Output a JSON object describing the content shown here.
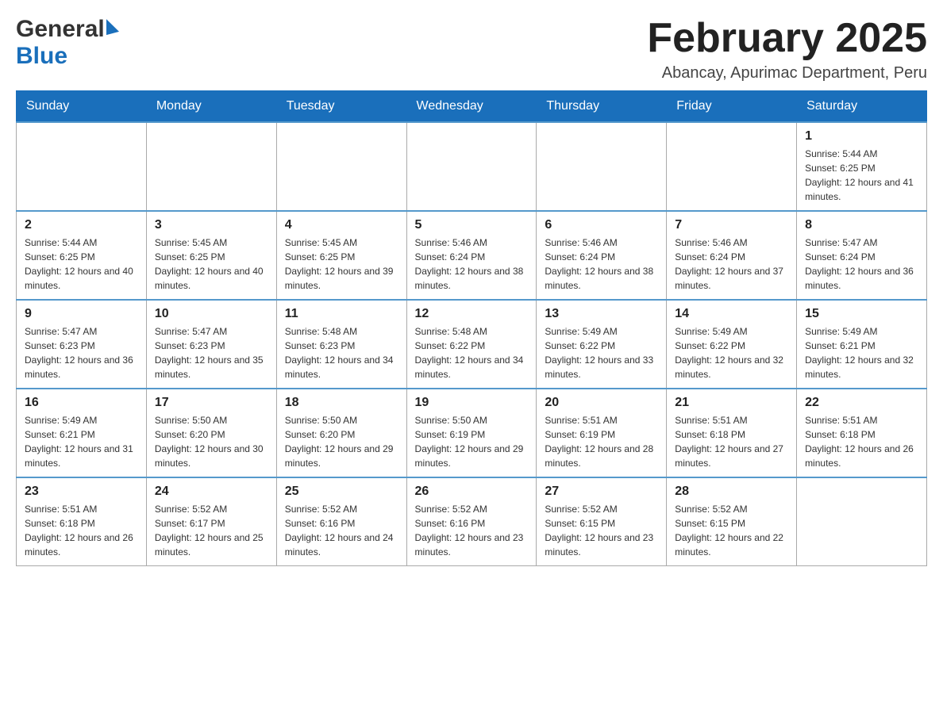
{
  "header": {
    "logo_general": "General",
    "logo_blue": "Blue",
    "month_title": "February 2025",
    "location": "Abancay, Apurimac Department, Peru"
  },
  "days_of_week": [
    "Sunday",
    "Monday",
    "Tuesday",
    "Wednesday",
    "Thursday",
    "Friday",
    "Saturday"
  ],
  "weeks": [
    [
      {
        "day": "",
        "info": ""
      },
      {
        "day": "",
        "info": ""
      },
      {
        "day": "",
        "info": ""
      },
      {
        "day": "",
        "info": ""
      },
      {
        "day": "",
        "info": ""
      },
      {
        "day": "",
        "info": ""
      },
      {
        "day": "1",
        "info": "Sunrise: 5:44 AM\nSunset: 6:25 PM\nDaylight: 12 hours and 41 minutes."
      }
    ],
    [
      {
        "day": "2",
        "info": "Sunrise: 5:44 AM\nSunset: 6:25 PM\nDaylight: 12 hours and 40 minutes."
      },
      {
        "day": "3",
        "info": "Sunrise: 5:45 AM\nSunset: 6:25 PM\nDaylight: 12 hours and 40 minutes."
      },
      {
        "day": "4",
        "info": "Sunrise: 5:45 AM\nSunset: 6:25 PM\nDaylight: 12 hours and 39 minutes."
      },
      {
        "day": "5",
        "info": "Sunrise: 5:46 AM\nSunset: 6:24 PM\nDaylight: 12 hours and 38 minutes."
      },
      {
        "day": "6",
        "info": "Sunrise: 5:46 AM\nSunset: 6:24 PM\nDaylight: 12 hours and 38 minutes."
      },
      {
        "day": "7",
        "info": "Sunrise: 5:46 AM\nSunset: 6:24 PM\nDaylight: 12 hours and 37 minutes."
      },
      {
        "day": "8",
        "info": "Sunrise: 5:47 AM\nSunset: 6:24 PM\nDaylight: 12 hours and 36 minutes."
      }
    ],
    [
      {
        "day": "9",
        "info": "Sunrise: 5:47 AM\nSunset: 6:23 PM\nDaylight: 12 hours and 36 minutes."
      },
      {
        "day": "10",
        "info": "Sunrise: 5:47 AM\nSunset: 6:23 PM\nDaylight: 12 hours and 35 minutes."
      },
      {
        "day": "11",
        "info": "Sunrise: 5:48 AM\nSunset: 6:23 PM\nDaylight: 12 hours and 34 minutes."
      },
      {
        "day": "12",
        "info": "Sunrise: 5:48 AM\nSunset: 6:22 PM\nDaylight: 12 hours and 34 minutes."
      },
      {
        "day": "13",
        "info": "Sunrise: 5:49 AM\nSunset: 6:22 PM\nDaylight: 12 hours and 33 minutes."
      },
      {
        "day": "14",
        "info": "Sunrise: 5:49 AM\nSunset: 6:22 PM\nDaylight: 12 hours and 32 minutes."
      },
      {
        "day": "15",
        "info": "Sunrise: 5:49 AM\nSunset: 6:21 PM\nDaylight: 12 hours and 32 minutes."
      }
    ],
    [
      {
        "day": "16",
        "info": "Sunrise: 5:49 AM\nSunset: 6:21 PM\nDaylight: 12 hours and 31 minutes."
      },
      {
        "day": "17",
        "info": "Sunrise: 5:50 AM\nSunset: 6:20 PM\nDaylight: 12 hours and 30 minutes."
      },
      {
        "day": "18",
        "info": "Sunrise: 5:50 AM\nSunset: 6:20 PM\nDaylight: 12 hours and 29 minutes."
      },
      {
        "day": "19",
        "info": "Sunrise: 5:50 AM\nSunset: 6:19 PM\nDaylight: 12 hours and 29 minutes."
      },
      {
        "day": "20",
        "info": "Sunrise: 5:51 AM\nSunset: 6:19 PM\nDaylight: 12 hours and 28 minutes."
      },
      {
        "day": "21",
        "info": "Sunrise: 5:51 AM\nSunset: 6:18 PM\nDaylight: 12 hours and 27 minutes."
      },
      {
        "day": "22",
        "info": "Sunrise: 5:51 AM\nSunset: 6:18 PM\nDaylight: 12 hours and 26 minutes."
      }
    ],
    [
      {
        "day": "23",
        "info": "Sunrise: 5:51 AM\nSunset: 6:18 PM\nDaylight: 12 hours and 26 minutes."
      },
      {
        "day": "24",
        "info": "Sunrise: 5:52 AM\nSunset: 6:17 PM\nDaylight: 12 hours and 25 minutes."
      },
      {
        "day": "25",
        "info": "Sunrise: 5:52 AM\nSunset: 6:16 PM\nDaylight: 12 hours and 24 minutes."
      },
      {
        "day": "26",
        "info": "Sunrise: 5:52 AM\nSunset: 6:16 PM\nDaylight: 12 hours and 23 minutes."
      },
      {
        "day": "27",
        "info": "Sunrise: 5:52 AM\nSunset: 6:15 PM\nDaylight: 12 hours and 23 minutes."
      },
      {
        "day": "28",
        "info": "Sunrise: 5:52 AM\nSunset: 6:15 PM\nDaylight: 12 hours and 22 minutes."
      },
      {
        "day": "",
        "info": ""
      }
    ]
  ]
}
